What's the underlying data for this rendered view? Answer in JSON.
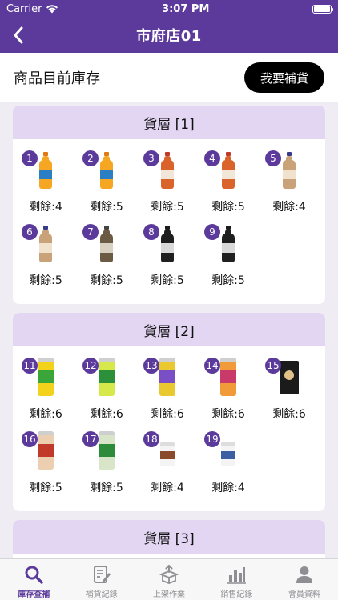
{
  "status_bar": {
    "carrier": "Carrier",
    "time": "3:07 PM"
  },
  "nav": {
    "title": "市府店01"
  },
  "header": {
    "label": "商品目前庫存",
    "restock_button": "我要補貨"
  },
  "colors": {
    "primary": "#5b3a9b",
    "shelf_header_bg": "#e3d6f3"
  },
  "shelves": [
    {
      "title": "貨層 [1]",
      "items": [
        {
          "num": "1",
          "remain": "剩餘:4",
          "icon": "orange-juice-bottle"
        },
        {
          "num": "2",
          "remain": "剩餘:5",
          "icon": "orange-juice-bottle"
        },
        {
          "num": "3",
          "remain": "剩餘:5",
          "icon": "red-tea-bottle"
        },
        {
          "num": "4",
          "remain": "剩餘:5",
          "icon": "red-tea-bottle"
        },
        {
          "num": "5",
          "remain": "剩餘:4",
          "icon": "milk-tea-bottle"
        },
        {
          "num": "6",
          "remain": "剩餘:5",
          "icon": "milk-tea-bottle"
        },
        {
          "num": "7",
          "remain": "剩餘:5",
          "icon": "coffee-bottle"
        },
        {
          "num": "8",
          "remain": "剩餘:5",
          "icon": "black-coffee-bottle"
        },
        {
          "num": "9",
          "remain": "剩餘:5",
          "icon": "black-coffee-bottle"
        }
      ]
    },
    {
      "title": "貨層 [2]",
      "items": [
        {
          "num": "11",
          "remain": "剩餘:6",
          "icon": "snack-canister"
        },
        {
          "num": "12",
          "remain": "剩餘:6",
          "icon": "snack-canister"
        },
        {
          "num": "13",
          "remain": "剩餘:6",
          "icon": "snack-canister"
        },
        {
          "num": "14",
          "remain": "剩餘:6",
          "icon": "snack-canister"
        },
        {
          "num": "15",
          "remain": "剩餘:6",
          "icon": "cookie-box"
        },
        {
          "num": "16",
          "remain": "剩餘:5",
          "icon": "chips-can"
        },
        {
          "num": "17",
          "remain": "剩餘:5",
          "icon": "chips-can"
        },
        {
          "num": "18",
          "remain": "剩餘:4",
          "icon": "noodle-cup"
        },
        {
          "num": "19",
          "remain": "剩餘:4",
          "icon": "noodle-cup"
        }
      ]
    },
    {
      "title": "貨層 [3]",
      "items": []
    }
  ],
  "tabs": [
    {
      "label": "庫存查補",
      "icon": "search-icon"
    },
    {
      "label": "補貨紀錄",
      "icon": "edit-document-icon"
    },
    {
      "label": "上架作業",
      "icon": "box-upload-icon"
    },
    {
      "label": "銷售紀錄",
      "icon": "bar-chart-icon"
    },
    {
      "label": "會員資料",
      "icon": "person-icon"
    }
  ]
}
